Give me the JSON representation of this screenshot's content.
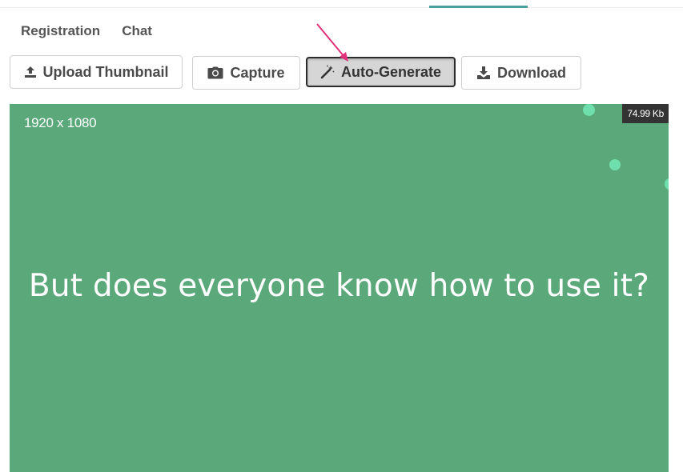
{
  "subnav": {
    "items": [
      {
        "label": "Registration"
      },
      {
        "label": "Chat"
      }
    ]
  },
  "toolbar": {
    "upload_label": "Upload Thumbnail",
    "capture_label": "Capture",
    "autogenerate_label": "Auto-Generate",
    "download_label": "Download"
  },
  "preview": {
    "resolution": "1920 x 1080",
    "file_size": "74.99 Kb",
    "headline": "But does everyone know how to use it?"
  },
  "icons": {
    "upload": "upload-icon",
    "capture": "camera-icon",
    "autogenerate": "magic-wand-icon",
    "download": "download-icon",
    "annotation": "arrow-pointer-icon"
  },
  "colors": {
    "preview_background": "#5ba87a",
    "accent_dot": "#6fe0ad",
    "annotation_arrow": "#e0307a",
    "active_tab": "#4aa0a0"
  }
}
